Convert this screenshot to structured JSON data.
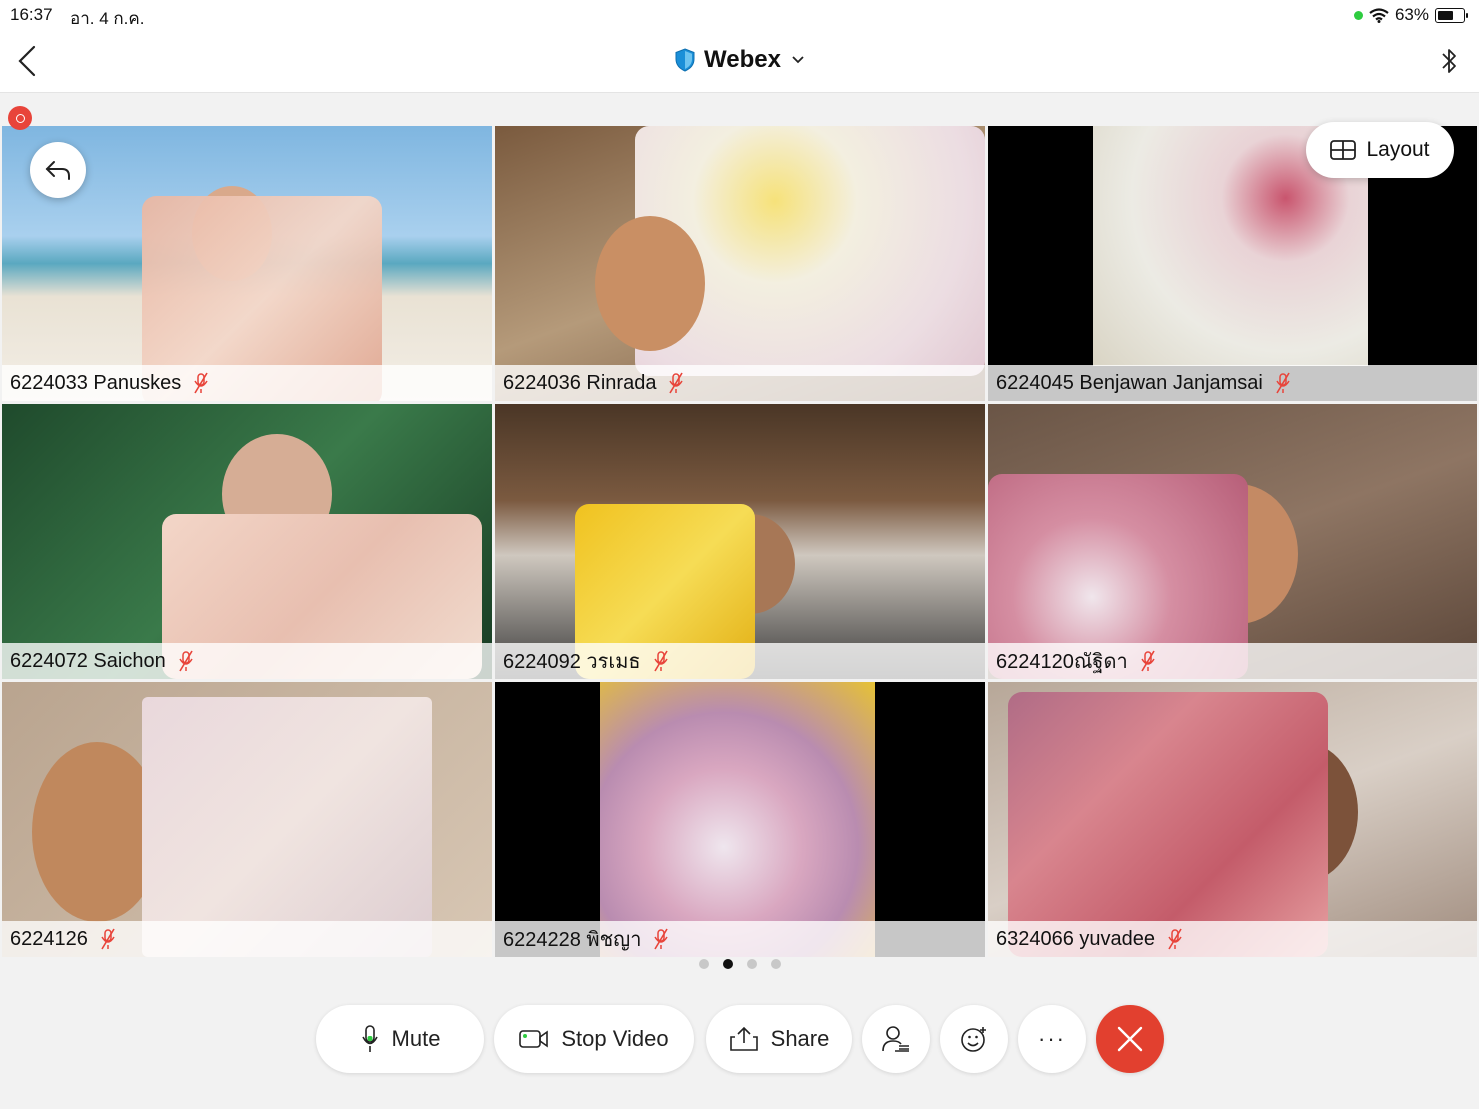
{
  "status_bar": {
    "time": "16:37",
    "date": "อา. 4 ก.ค.",
    "battery": "63%"
  },
  "nav": {
    "title": "Webex"
  },
  "layout_label": "Layout",
  "participants": [
    {
      "name": "6224033 Panuskes"
    },
    {
      "name": "6224036 Rinrada"
    },
    {
      "name": "6224045 Benjawan Janjamsai"
    },
    {
      "name": "6224072 Saichon"
    },
    {
      "name": "6224092 วรเมธ"
    },
    {
      "name": "6224120ณัฐิดา"
    },
    {
      "name": "6224126"
    },
    {
      "name": "6224228 พิชญา"
    },
    {
      "name": "6324066 yuvadee"
    }
  ],
  "pager": {
    "pages": 4,
    "active": 2
  },
  "controls": {
    "mute": "Mute",
    "stop_video": "Stop Video",
    "share": "Share",
    "more": "···"
  },
  "colors": {
    "end_call": "#e2402f",
    "mic_off": "#e8443a",
    "accent": "#1a8fd8"
  }
}
